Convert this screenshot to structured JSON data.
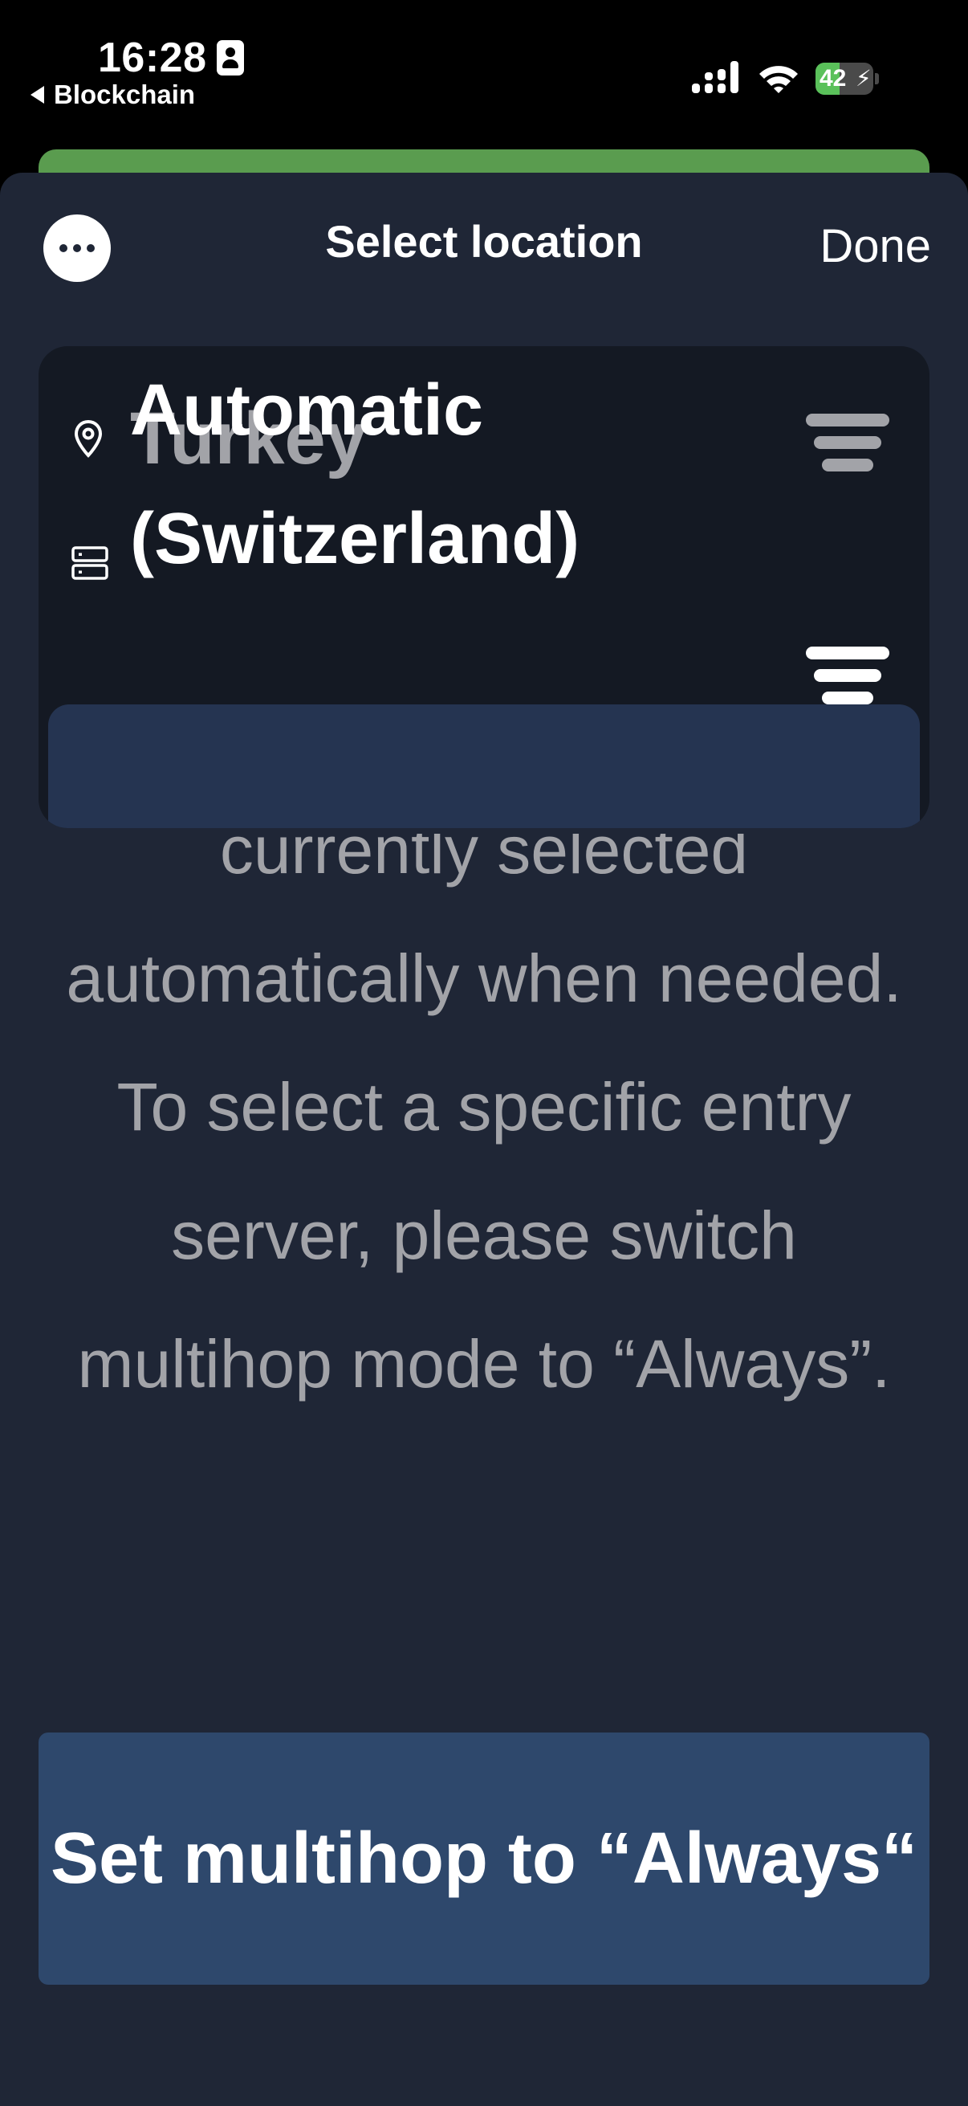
{
  "status_bar": {
    "time": "16:28",
    "back_app": "Blockchain",
    "battery_percent": "42",
    "battery_level": 0.42
  },
  "sheet": {
    "title": "Select location",
    "done_label": "Done"
  },
  "locations": {
    "current": {
      "label": "Turkey",
      "icon": "location-pin-icon"
    },
    "automatic": {
      "label": "Automatic (Switzerland)",
      "icon": "server-icon"
    }
  },
  "info": {
    "text": "currently selected automatically when needed. To select a specific entry server, please switch multihop mode to “Always”."
  },
  "cta": {
    "label": "Set multihop to “Always“"
  },
  "colors": {
    "sheet_background": "#1f2636",
    "card_background": "#141923",
    "selected_row": "#253451",
    "cta_background": "#2e486c",
    "muted_text": "#a2a3a8",
    "peek_green": "#5a9c4f",
    "battery_green": "#5ac15a"
  }
}
